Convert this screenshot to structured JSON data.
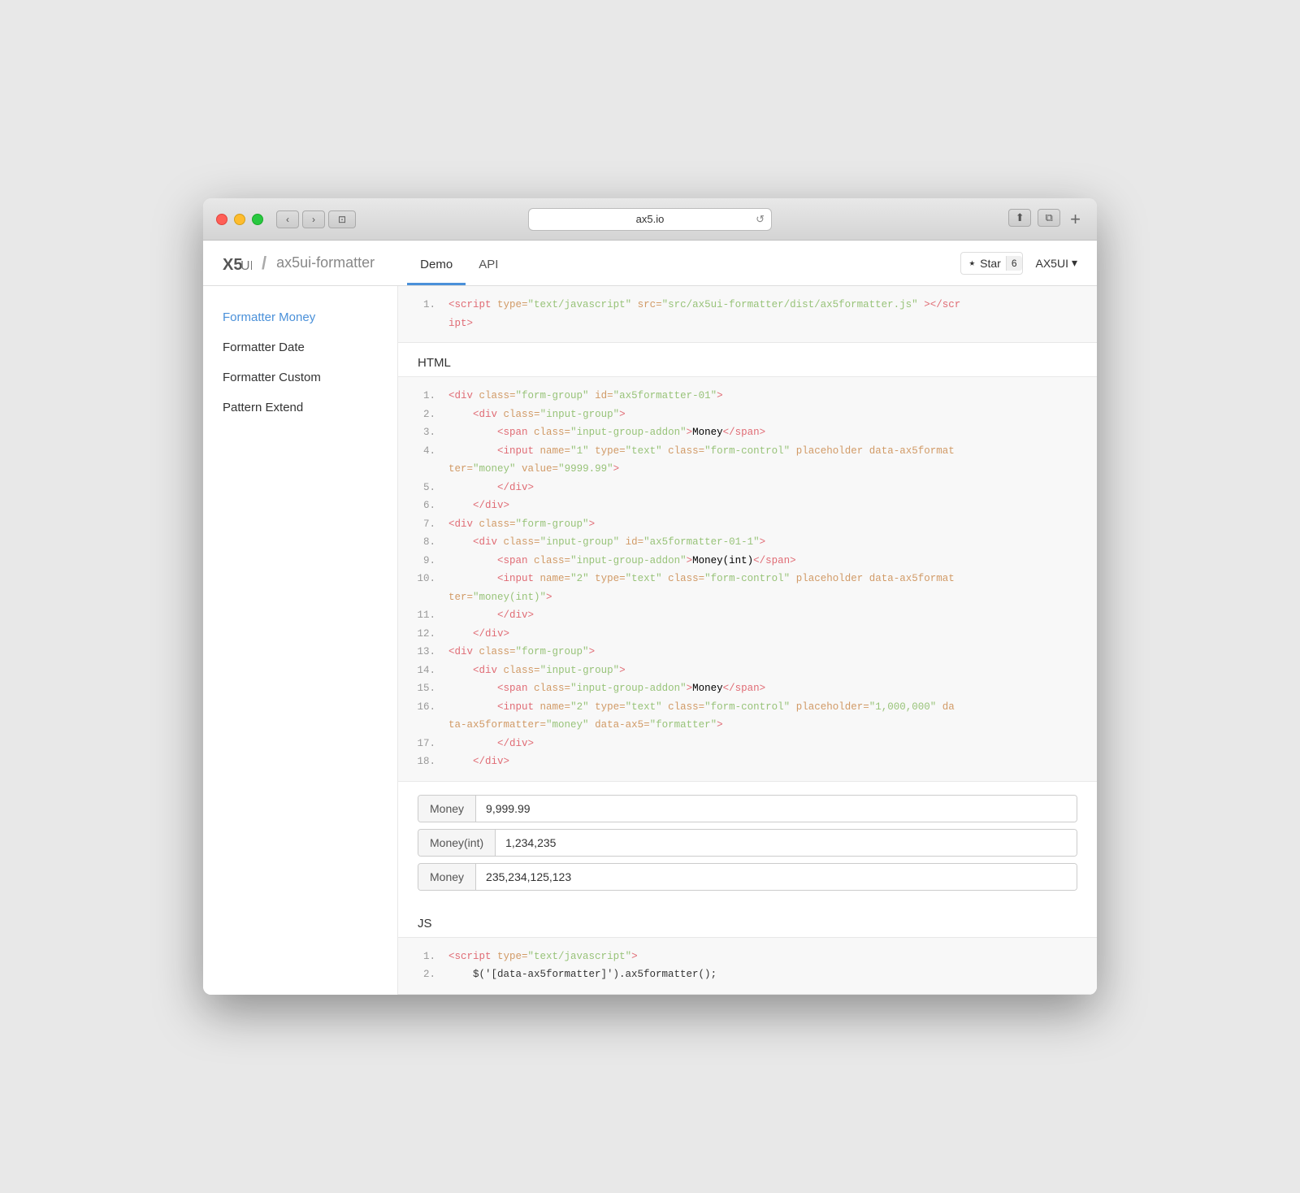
{
  "browser": {
    "url": "ax5.io",
    "refresh_label": "↺",
    "back_label": "‹",
    "forward_label": "›",
    "plus_label": "+",
    "share_label": "⬆",
    "duplicate_label": "⧉"
  },
  "header": {
    "logo_x5": "X5",
    "logo_ui": "UI",
    "logo_separator": "/",
    "logo_project": "ax5ui-formatter",
    "nav": [
      {
        "label": "Demo",
        "active": true
      },
      {
        "label": "API",
        "active": false
      }
    ],
    "github_label": "⭑ Star",
    "star_count": "6",
    "ax5ui_label": "AX5UI",
    "dropdown_arrow": "▾"
  },
  "sidebar": {
    "items": [
      {
        "label": "Formatter Money",
        "active": true
      },
      {
        "label": "Formatter Date",
        "active": false
      },
      {
        "label": "Formatter Custom",
        "active": false
      },
      {
        "label": "Pattern Extend",
        "active": false
      }
    ]
  },
  "content": {
    "top_code": {
      "lines": [
        {
          "number": "1.",
          "parts": [
            {
              "type": "tag",
              "text": "<script"
            },
            {
              "type": "attr",
              "text": " type="
            },
            {
              "type": "string",
              "text": "\"text/javascript\""
            },
            {
              "type": "attr",
              "text": " src="
            },
            {
              "type": "string",
              "text": "\"src/ax5ui-formatter/dist/ax5formatter.js\""
            },
            {
              "type": "tag",
              "text": "></"
            },
            {
              "type": "tag",
              "text": "scr"
            }
          ]
        },
        {
          "number": "",
          "parts": [
            {
              "type": "text",
              "text": "    ipt>"
            }
          ]
        }
      ]
    },
    "html_section_label": "HTML",
    "html_code": {
      "lines": [
        {
          "number": "1.",
          "html": "<span class='c-tag'>&lt;div</span> <span class='c-attr'>class=</span><span class='c-string'>\"form-group\"</span> <span class='c-attr'>id=</span><span class='c-string'>\"ax5formatter-01\"</span><span class='c-tag'>&gt;</span>"
        },
        {
          "number": "2.",
          "html": "&nbsp;&nbsp;&nbsp;&nbsp;<span class='c-tag'>&lt;div</span> <span class='c-attr'>class=</span><span class='c-string'>\"input-group\"</span><span class='c-tag'>&gt;</span>"
        },
        {
          "number": "3.",
          "html": "&nbsp;&nbsp;&nbsp;&nbsp;&nbsp;&nbsp;&nbsp;&nbsp;<span class='c-tag'>&lt;span</span> <span class='c-attr'>class=</span><span class='c-string'>\"input-group-addon\"</span><span class='c-tag'>&gt;</span><span class='c-text'>Money</span><span class='c-tag'>&lt;/span&gt;</span>"
        },
        {
          "number": "4.",
          "html": "&nbsp;&nbsp;&nbsp;&nbsp;&nbsp;&nbsp;&nbsp;&nbsp;<span class='c-tag'>&lt;input</span> <span class='c-attr'>name=</span><span class='c-string'>\"1\"</span> <span class='c-attr'>type=</span><span class='c-string'>\"text\"</span> <span class='c-attr'>class=</span><span class='c-string'>\"form-control\"</span> <span class='c-attr'>placeholder</span> <span class='c-attr'>data-ax5format</span>"
        },
        {
          "number": "",
          "html": "<span class='c-attr'>ter=</span><span class='c-string'>\"money\"</span> <span class='c-attr'>value=</span><span class='c-string'>\"9999.99\"</span><span class='c-tag'>&gt;</span>"
        },
        {
          "number": "5.",
          "html": "&nbsp;&nbsp;&nbsp;&nbsp;&nbsp;&nbsp;&nbsp;&nbsp;<span class='c-tag'>&lt;/div&gt;</span>"
        },
        {
          "number": "6.",
          "html": "&nbsp;&nbsp;&nbsp;&nbsp;<span class='c-tag'>&lt;/div&gt;</span>"
        },
        {
          "number": "7.",
          "html": "<span class='c-tag'>&lt;div</span> <span class='c-attr'>class=</span><span class='c-string'>\"form-group\"</span><span class='c-tag'>&gt;</span>"
        },
        {
          "number": "8.",
          "html": "&nbsp;&nbsp;&nbsp;&nbsp;<span class='c-tag'>&lt;div</span> <span class='c-attr'>class=</span><span class='c-string'>\"input-group\"</span> <span class='c-attr'>id=</span><span class='c-string'>\"ax5formatter-01-1\"</span><span class='c-tag'>&gt;</span>"
        },
        {
          "number": "9.",
          "html": "&nbsp;&nbsp;&nbsp;&nbsp;&nbsp;&nbsp;&nbsp;&nbsp;<span class='c-tag'>&lt;span</span> <span class='c-attr'>class=</span><span class='c-string'>\"input-group-addon\"</span><span class='c-tag'>&gt;</span><span class='c-text'>Money(int)</span><span class='c-tag'>&lt;/span&gt;</span>"
        },
        {
          "number": "10.",
          "html": "&nbsp;&nbsp;&nbsp;&nbsp;&nbsp;&nbsp;&nbsp;&nbsp;<span class='c-tag'>&lt;input</span> <span class='c-attr'>name=</span><span class='c-string'>\"2\"</span> <span class='c-attr'>type=</span><span class='c-string'>\"text\"</span> <span class='c-attr'>class=</span><span class='c-string'>\"form-control\"</span> <span class='c-attr'>placeholder</span> <span class='c-attr'>data-ax5format</span>"
        },
        {
          "number": "",
          "html": "<span class='c-attr'>ter=</span><span class='c-string'>\"money(int)\"</span><span class='c-tag'>&gt;</span>"
        },
        {
          "number": "11.",
          "html": "&nbsp;&nbsp;&nbsp;&nbsp;&nbsp;&nbsp;&nbsp;&nbsp;<span class='c-tag'>&lt;/div&gt;</span>"
        },
        {
          "number": "12.",
          "html": "&nbsp;&nbsp;&nbsp;&nbsp;<span class='c-tag'>&lt;/div&gt;</span>"
        },
        {
          "number": "13.",
          "html": "<span class='c-tag'>&lt;div</span> <span class='c-attr'>class=</span><span class='c-string'>\"form-group\"</span><span class='c-tag'>&gt;</span>"
        },
        {
          "number": "14.",
          "html": "&nbsp;&nbsp;&nbsp;&nbsp;<span class='c-tag'>&lt;div</span> <span class='c-attr'>class=</span><span class='c-string'>\"input-group\"</span><span class='c-tag'>&gt;</span>"
        },
        {
          "number": "15.",
          "html": "&nbsp;&nbsp;&nbsp;&nbsp;&nbsp;&nbsp;&nbsp;&nbsp;<span class='c-tag'>&lt;span</span> <span class='c-attr'>class=</span><span class='c-string'>\"input-group-addon\"</span><span class='c-tag'>&gt;</span><span class='c-text'>Money</span><span class='c-tag'>&lt;/span&gt;</span>"
        },
        {
          "number": "16.",
          "html": "&nbsp;&nbsp;&nbsp;&nbsp;&nbsp;&nbsp;&nbsp;&nbsp;<span class='c-tag'>&lt;input</span> <span class='c-attr'>name=</span><span class='c-string'>\"2\"</span> <span class='c-attr'>type=</span><span class='c-string'>\"text\"</span> <span class='c-attr'>class=</span><span class='c-string'>\"form-control\"</span> <span class='c-attr'>placeholder=</span><span class='c-string'>\"1,000,000\"</span> <span class='c-attr'>da</span>"
        },
        {
          "number": "",
          "html": "<span class='c-attr'>ta-ax5formatter=</span><span class='c-string'>\"money\"</span> <span class='c-attr'>data-ax5=</span><span class='c-string'>\"formatter\"</span><span class='c-tag'>&gt;</span>"
        },
        {
          "number": "17.",
          "html": "&nbsp;&nbsp;&nbsp;&nbsp;&nbsp;&nbsp;&nbsp;&nbsp;<span class='c-tag'>&lt;/div&gt;</span>"
        },
        {
          "number": "18.",
          "html": "&nbsp;&nbsp;&nbsp;&nbsp;<span class='c-tag'>&lt;/div&gt;</span>"
        }
      ]
    },
    "form_groups": [
      {
        "addon": "Money",
        "value": "9,999.99"
      },
      {
        "addon": "Money(int)",
        "value": "1,234,235"
      },
      {
        "addon": "Money",
        "value": "235,234,125,123"
      }
    ],
    "js_section_label": "JS",
    "js_code": {
      "lines": [
        {
          "number": "1.",
          "html": "<span class='c-tag'>&lt;script</span> <span class='c-attr'>type=</span><span class='c-string'>\"text/javascript\"</span><span class='c-tag'>&gt;</span>"
        },
        {
          "number": "2.",
          "html": "&nbsp;&nbsp;&nbsp;&nbsp;<span class='c-text'>$('[data-ax5formatter]').ax5formatter();</span>"
        }
      ]
    }
  }
}
